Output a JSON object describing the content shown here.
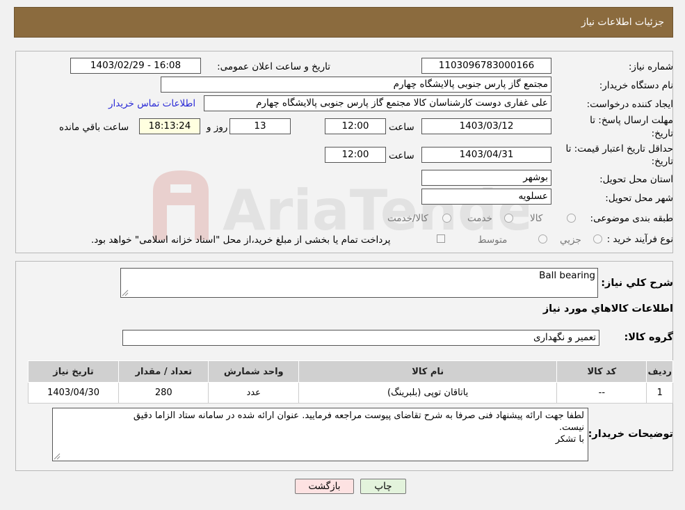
{
  "header": {
    "title": "جزئیات اطلاعات نیاز"
  },
  "form": {
    "need_number_label": "شماره نیاز:",
    "need_number": "1103096783000166",
    "announce_label": "تاریخ و ساعت اعلان عمومی:",
    "announce_value": "1403/02/29 - 16:08",
    "buyer_org_label": "نام دستگاه خریدار:",
    "buyer_org": "مجتمع گاز پارس جنوبی  پالایشگاه چهارم",
    "creator_label": "ایجاد کننده درخواست:",
    "creator": "علی غفاری دوست کارشناسان کالا مجتمع گاز پارس جنوبی  پالایشگاه چهارم",
    "contact_link": "اطلاعات تماس خریدار",
    "deadline_label_1": "مهلت ارسال پاسخ: تا",
    "deadline_label_2": "تاریخ:",
    "deadline_date": "1403/03/12",
    "time_label": "ساعت",
    "deadline_time": "12:00",
    "days_value": "13",
    "days_label": "روز و",
    "remaining_time": "18:13:24",
    "remaining_label": "ساعت باقي مانده",
    "validity_label_1": "حداقل تاریخ اعتبار قیمت: تا",
    "validity_label_2": "تاریخ:",
    "validity_date": "1403/04/31",
    "validity_time_label": "ساعت",
    "validity_time": "12:00",
    "province_label": "استان محل تحویل:",
    "province": "بوشهر",
    "city_label": "شهر محل تحویل:",
    "city": "عسلویه",
    "category_label": "طبقه بندی موضوعی:",
    "category_options": [
      "کالا",
      "خدمت",
      "کالا/خدمت"
    ],
    "process_label": "نوع فرآیند خرید :",
    "process_options": [
      "جزیي",
      "متوسط"
    ],
    "payment_note": "پرداخت تمام یا بخشی از مبلغ خرید،از محل \"اسناد خزانه اسلامی\" خواهد بود."
  },
  "details": {
    "summary_label": "شرح کلي نیاز:",
    "summary_value": "Ball bearing",
    "items_heading": "اطلاعات کالاهاي مورد نیاز",
    "group_label": "گروه کالا:",
    "group_value": "تعمیر و نگهداری",
    "table": {
      "headers": [
        "ردیف",
        "کد کالا",
        "نام کالا",
        "واحد شمارش",
        "تعداد / مقدار",
        "تاریخ نیاز"
      ],
      "rows": [
        [
          "1",
          "--",
          "یاتاقان توپی (بلبرینگ)",
          "عدد",
          "280",
          "1403/04/30"
        ]
      ]
    },
    "buyer_notes_label": "توضیحات خریدار:",
    "buyer_notes_line1": "لطفا جهت ارائه پیشنهاد فنی صرفا به شرح تقاضای پیوست مراجعه فرمایید. عنوان ارائه شده در سامانه ستاد الزاما دقیق",
    "buyer_notes_line2": "نیست.",
    "buyer_notes_line3": "با تشکر"
  },
  "buttons": {
    "print": "چاپ",
    "back": "بازگشت"
  },
  "watermark": {
    "text": "AriaTender.neT"
  },
  "colors": {
    "header_bg": "#8b6b3e",
    "table_header_bg": "#d0d0d0",
    "remaining_bg": "#ffffe0",
    "back_btn_bg": "#fde2e2",
    "print_btn_bg": "#e3f3dc"
  }
}
